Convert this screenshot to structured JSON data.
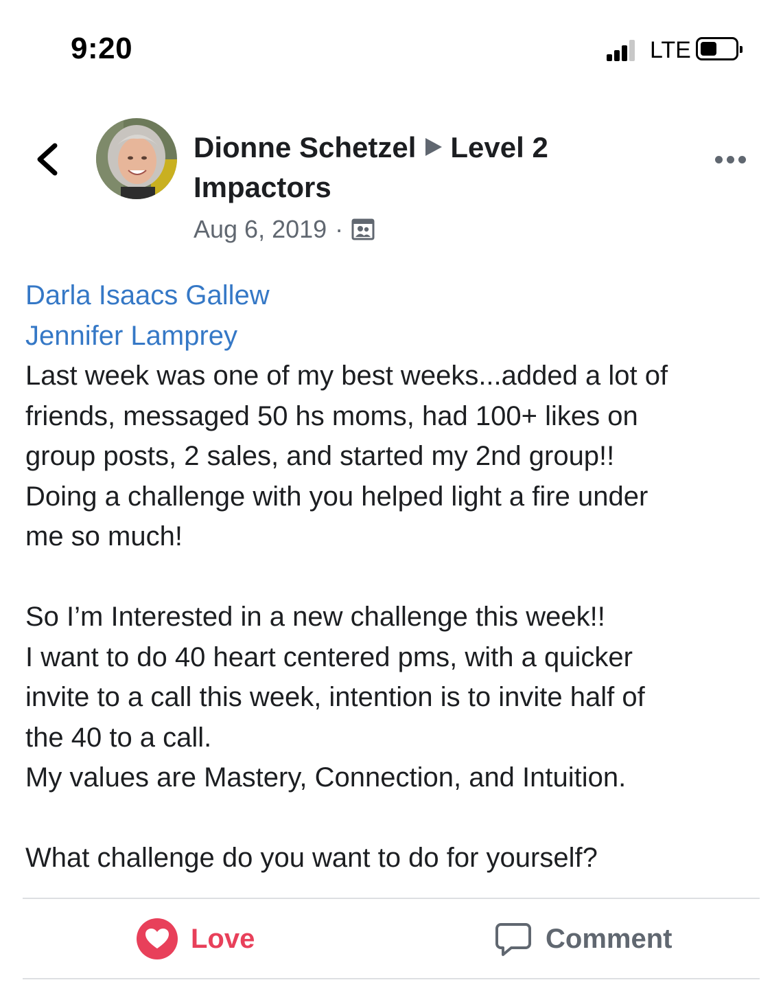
{
  "status_bar": {
    "time": "9:20",
    "network": "LTE",
    "battery_level": 0.45,
    "signal_bars": 3
  },
  "header": {
    "back_icon": "chevron-left-icon",
    "author_name": "Dionne Schetzel",
    "group_name": "Level 2 Impactors",
    "date": "Aug 6, 2019",
    "separator": "·",
    "audience_icon": "group-audience-icon",
    "more_icon": "more-dots-icon"
  },
  "post": {
    "mentions": [
      "Darla Isaacs Gallew",
      "Jennifer Lamprey"
    ],
    "paragraph1": [
      "Last week was one of my best weeks...added a lot of",
      "friends, messaged 50 hs moms, had 100+ likes on",
      "group posts, 2 sales, and started my 2nd group!!",
      "Doing a challenge with you helped light a fire under",
      "me so much!"
    ],
    "paragraph2": [
      "So I’m Interested in a new challenge this week!!",
      "I want to do 40 heart centered pms, with a quicker",
      "invite to a call this week, intention is to invite half of",
      "the 40 to a call.",
      "My values are Mastery, Connection, and Intuition."
    ],
    "paragraph3": [
      "What challenge do you want to do for yourself?"
    ]
  },
  "actions": {
    "love_label": "Love",
    "love_icon": "heart-icon",
    "love_color": "#e8405a",
    "comment_label": "Comment",
    "comment_icon": "comment-bubble-icon"
  },
  "colors": {
    "mention": "#3578c6",
    "secondary_text": "#606770"
  }
}
